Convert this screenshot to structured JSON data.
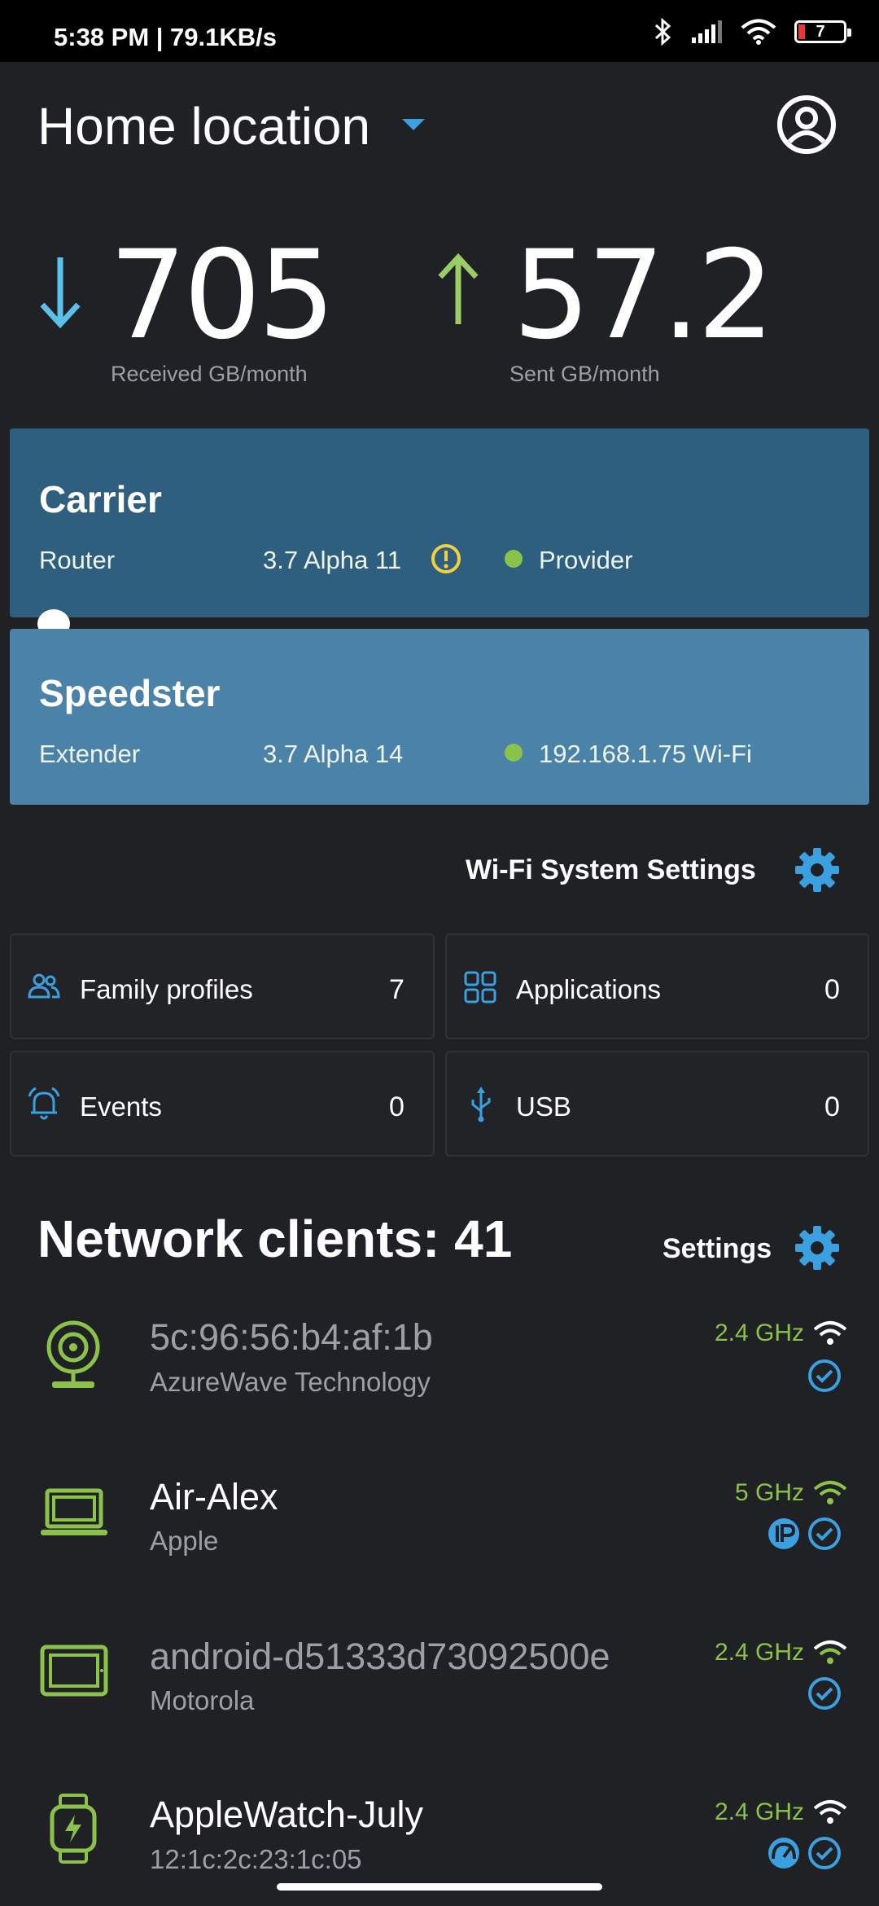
{
  "status": {
    "time_speed": "5:38 PM | 79.1KB/s",
    "battery": "7"
  },
  "header": {
    "title": "Home location"
  },
  "stats": {
    "received_value": "705",
    "received_label": "Received GB/month",
    "sent_value": "57.2",
    "sent_label": "Sent GB/month"
  },
  "devices": [
    {
      "name": "Carrier",
      "role": "Router",
      "version": "3.7 Alpha 11",
      "status": "Provider",
      "warning": true
    },
    {
      "name": "Speedster",
      "role": "Extender",
      "version": "3.7 Alpha 14",
      "status": "192.168.1.75 Wi-Fi",
      "warning": false
    }
  ],
  "wifi_settings_label": "Wi-Fi System Settings",
  "tiles": [
    {
      "label": "Family profiles",
      "count": "7",
      "icon": "family-icon"
    },
    {
      "label": "Applications",
      "count": "0",
      "icon": "apps-grid-icon"
    },
    {
      "label": "Events",
      "count": "0",
      "icon": "bell-icon"
    },
    {
      "label": "USB",
      "count": "0",
      "icon": "usb-icon"
    }
  ],
  "clients": {
    "title": "Network clients: 41",
    "settings_label": "Settings",
    "items": [
      {
        "name": "5c:96:56:b4:af:1b",
        "sub": "AzureWave Technology",
        "band": "2.4 GHz",
        "icon": "webcam-icon",
        "dim": true
      },
      {
        "name": "Air-Alex",
        "sub": "Apple",
        "band": "5 GHz",
        "icon": "laptop-icon",
        "dim": false
      },
      {
        "name": "android-d51333d73092500e",
        "sub": "Motorola",
        "band": "2.4 GHz",
        "icon": "tablet-icon",
        "dim": true
      },
      {
        "name": "AppleWatch-July",
        "sub": "12:1c:2c:23:1c:05",
        "band": "2.4 GHz",
        "icon": "smartwatch-icon",
        "dim": false
      }
    ]
  },
  "colors": {
    "background": "#202124",
    "router_card": "#2e5f7e",
    "extender_card": "#4a82a8",
    "accent_blue": "#3aa0e0",
    "accent_green": "#8bc34a",
    "received_arrow": "#5bc0ea",
    "sent_arrow": "#9ccc65",
    "warning": "#f4d03f"
  }
}
